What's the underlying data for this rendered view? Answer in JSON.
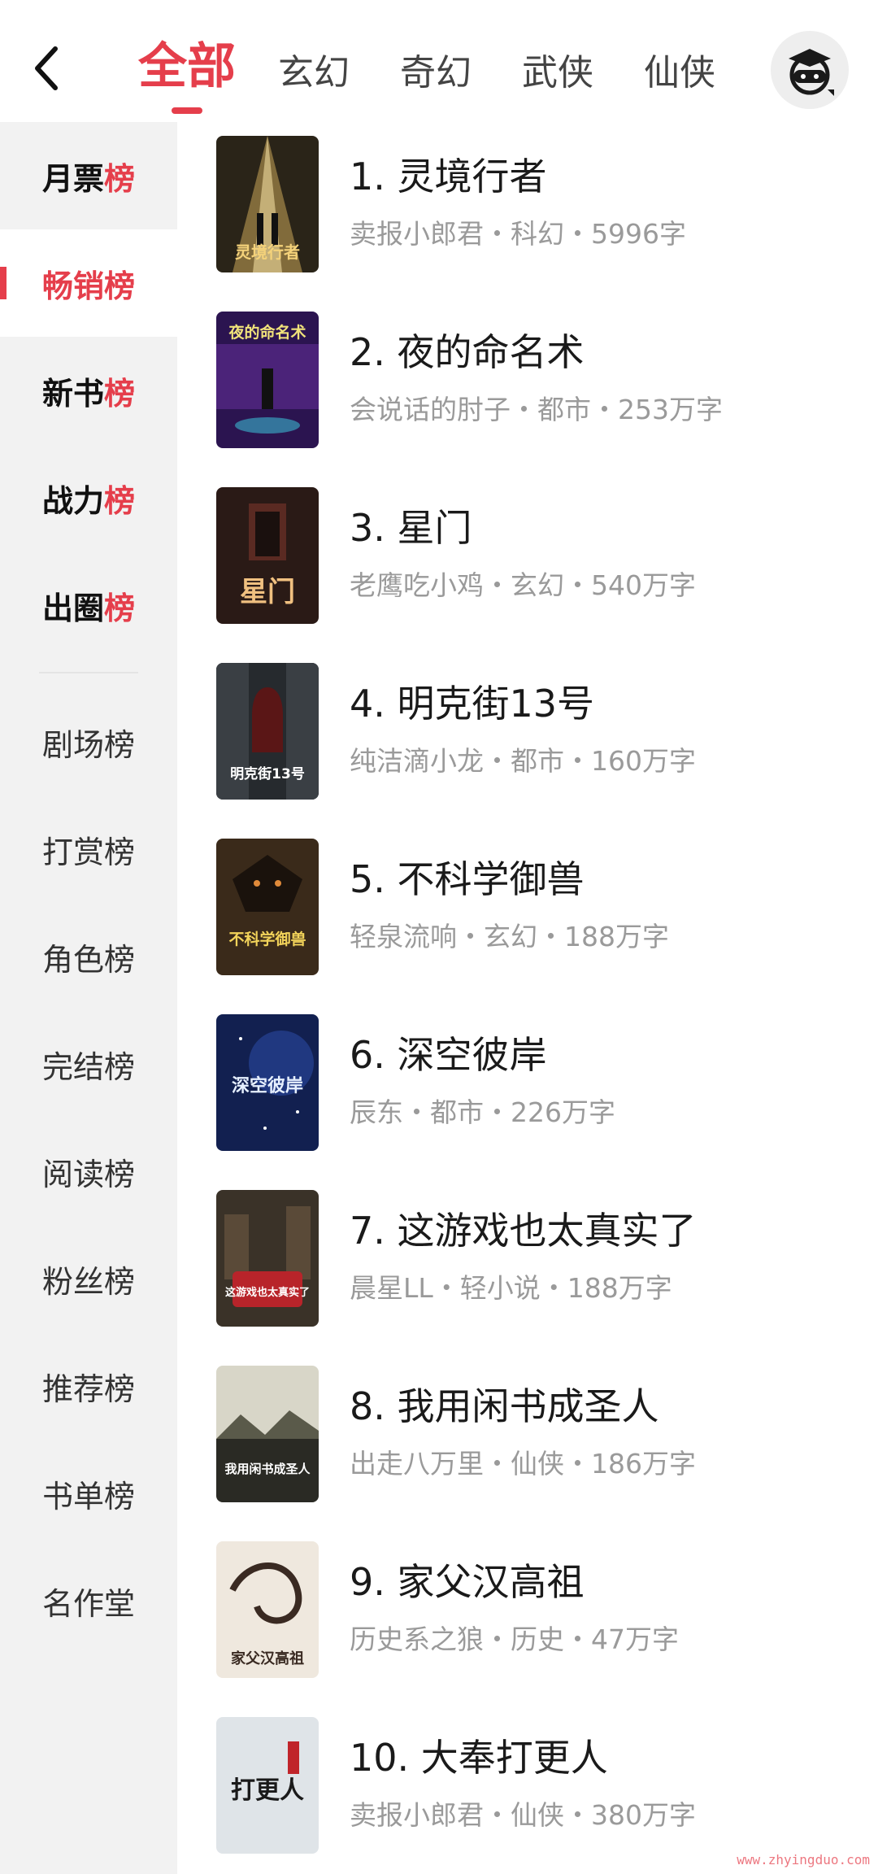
{
  "header": {
    "tabs": [
      {
        "label": "全部",
        "active": true
      },
      {
        "label": "玄幻",
        "active": false
      },
      {
        "label": "奇幻",
        "active": false
      },
      {
        "label": "武侠",
        "active": false
      },
      {
        "label": "仙侠",
        "active": false
      }
    ],
    "back_icon": "chevron-left-icon",
    "avatar_icon": "reader-avatar-icon"
  },
  "sidebar": {
    "items": [
      {
        "prefix": "月票",
        "suffix": "榜",
        "bold": true,
        "active": false
      },
      {
        "prefix": "畅销",
        "suffix": "榜",
        "bold": true,
        "active": true
      },
      {
        "prefix": "新书",
        "suffix": "榜",
        "bold": true,
        "active": false
      },
      {
        "prefix": "战力",
        "suffix": "榜",
        "bold": true,
        "active": false
      },
      {
        "prefix": "出圈",
        "suffix": "榜",
        "bold": true,
        "active": false
      },
      {
        "label": "剧场榜"
      },
      {
        "label": "打赏榜"
      },
      {
        "label": "角色榜"
      },
      {
        "label": "完结榜"
      },
      {
        "label": "阅读榜"
      },
      {
        "label": "粉丝榜"
      },
      {
        "label": "推荐榜"
      },
      {
        "label": "书单榜"
      },
      {
        "label": "名作堂"
      }
    ]
  },
  "books": [
    {
      "title": "1. 灵境行者",
      "meta": "卖报小郎君・科幻・5996字",
      "cover_title": "灵境行者"
    },
    {
      "title": "2. 夜的命名术",
      "meta": "会说话的肘子・都市・253万字",
      "cover_title": "夜的命名术"
    },
    {
      "title": "3. 星门",
      "meta": "老鹰吃小鸡・玄幻・540万字",
      "cover_title": "星门"
    },
    {
      "title": "4. 明克街13号",
      "meta": "纯洁滴小龙・都市・160万字",
      "cover_title": "明克街13号"
    },
    {
      "title": "5. 不科学御兽",
      "meta": "轻泉流响・玄幻・188万字",
      "cover_title": "不科学御兽"
    },
    {
      "title": "6. 深空彼岸",
      "meta": "辰东・都市・226万字",
      "cover_title": "深空彼岸"
    },
    {
      "title": "7. 这游戏也太真实了",
      "meta": "晨星LL・轻小说・188万字",
      "cover_title": "这游戏也太真实了"
    },
    {
      "title": "8. 我用闲书成圣人",
      "meta": "出走八万里・仙侠・186万字",
      "cover_title": "我用闲书成圣人"
    },
    {
      "title": "9. 家父汉高祖",
      "meta": "历史系之狼・历史・47万字",
      "cover_title": "家父汉高祖"
    },
    {
      "title": "10. 大奉打更人",
      "meta": "卖报小郎君・仙侠・380万字",
      "cover_title": "打更人"
    }
  ],
  "colors": {
    "accent": "#e53e4b",
    "sidebar_bg": "#f2f2f2",
    "meta_text": "#9a9a9a"
  },
  "watermark": "www.zhyingduo.com"
}
